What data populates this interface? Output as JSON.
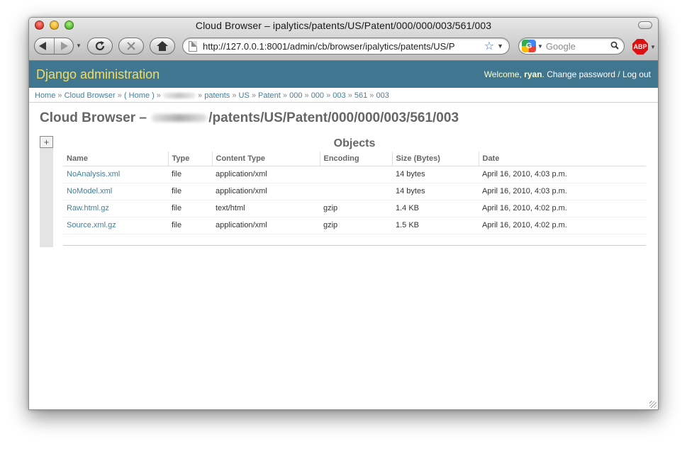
{
  "window": {
    "title": "Cloud Browser – ipalytics/patents/US/Patent/000/000/003/561/003"
  },
  "toolbar": {
    "url": "http://127.0.0.1:8001/admin/cb/browser/ipalytics/patents/US/P",
    "search_placeholder": "Google",
    "google_logo": "G",
    "abp_label": "ABP"
  },
  "header": {
    "branding": "Django administration",
    "welcome": "Welcome,",
    "username": "ryan",
    "change_password": "Change password",
    "separator": " / ",
    "logout": "Log out"
  },
  "breadcrumbs": {
    "sep": " » ",
    "items": [
      "Home",
      "Cloud Browser",
      "( Home )",
      "patents",
      "US",
      "Patent",
      "000",
      "000",
      "003",
      "561",
      "003"
    ]
  },
  "main": {
    "title_prefix": "Cloud Browser – ",
    "title_suffix": "/patents/US/Patent/000/000/003/561/003",
    "toggle_label": "+",
    "objects_heading": "Objects"
  },
  "table": {
    "columns": [
      "Name",
      "Type",
      "Content Type",
      "Encoding",
      "Size (Bytes)",
      "Date"
    ],
    "rows": [
      [
        "NoAnalysis.xml",
        "file",
        "application/xml",
        "",
        "14 bytes",
        "April 16, 2010, 4:03 p.m."
      ],
      [
        "NoModel.xml",
        "file",
        "application/xml",
        "",
        "14 bytes",
        "April 16, 2010, 4:03 p.m."
      ],
      [
        "Raw.html.gz",
        "file",
        "text/html",
        "gzip",
        "1.4 KB",
        "April 16, 2010, 4:02 p.m."
      ],
      [
        "Source.xml.gz",
        "file",
        "application/xml",
        "gzip",
        "1.5 KB",
        "April 16, 2010, 4:02 p.m."
      ]
    ]
  },
  "icons": {
    "back": "back-arrow-icon",
    "forward": "forward-arrow-icon",
    "reload": "reload-icon",
    "stop": "stop-icon",
    "home": "home-icon",
    "star": "bookmark-star-icon",
    "search": "magnifier-icon"
  },
  "colors": {
    "header_bg": "#417690",
    "branding": "#f5dd5d",
    "link": "#447e9b"
  }
}
